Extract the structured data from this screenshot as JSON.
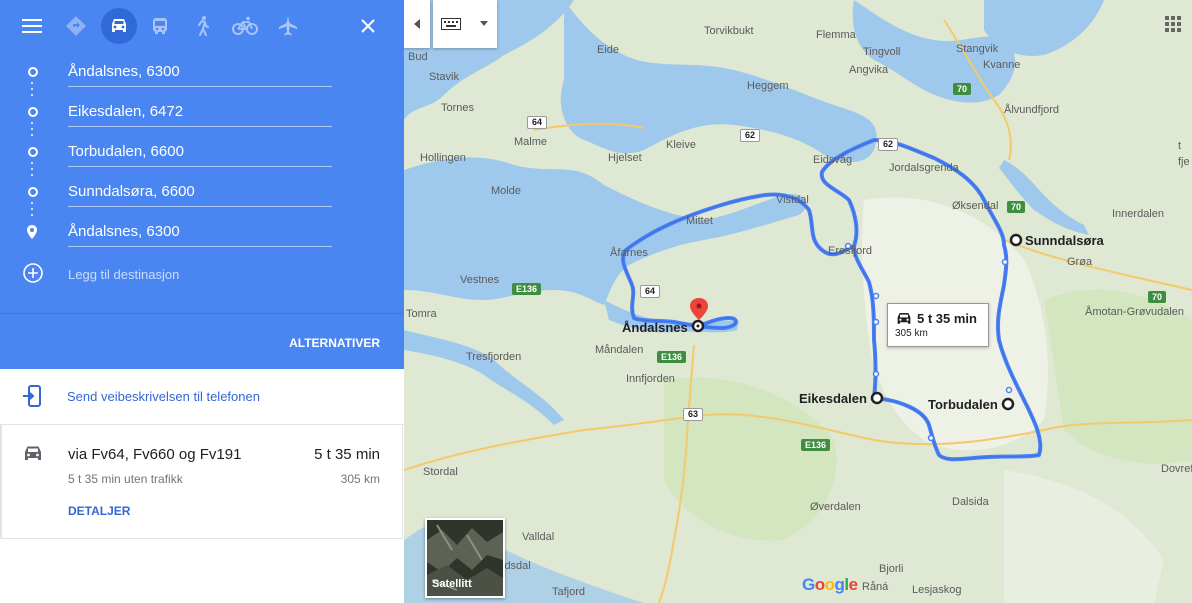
{
  "panel": {
    "modes": [
      {
        "name": "best",
        "icon": "directions-diamond-icon"
      },
      {
        "name": "car",
        "icon": "car-icon",
        "active": true
      },
      {
        "name": "transit",
        "icon": "bus-icon"
      },
      {
        "name": "walk",
        "icon": "walk-icon"
      },
      {
        "name": "bike",
        "icon": "bike-icon"
      },
      {
        "name": "flight",
        "icon": "airplane-icon"
      }
    ],
    "stops": [
      "Åndalsnes, 6300",
      "Eikesdalen, 6472",
      "Torbudalen, 6600",
      "Sunndalsøra, 6600",
      "Åndalsnes, 6300"
    ],
    "add_destination_placeholder": "Legg til destinasjon",
    "alternatives_label": "ALTERNATIVER",
    "send_to_phone_label": "Send veibeskrivelsen til telefonen",
    "route": {
      "via": "via Fv64, Fv660 og Fv191",
      "time": "5 t 35 min",
      "no_traffic": "5 t 35 min uten trafikk",
      "distance": "305 km",
      "details_label": "DETALJER"
    },
    "colors": {
      "header": "#4a86f2",
      "link": "#3367d6"
    }
  },
  "map": {
    "route_color": "#4a80f5",
    "info_box": {
      "time": "5 t 35 min",
      "distance": "305 km"
    },
    "satellite_label": "Satellitt",
    "logo": "Google",
    "places": {
      "bud": "Bud",
      "eide": "Eide",
      "torvikbukt": "Torvikbukt",
      "flemma": "Flemma",
      "tingvoll": "Tingvoll",
      "stangvik": "Stangvik",
      "kvanne": "Kvanne",
      "stavik": "Stavik",
      "angvika": "Angvika",
      "heggem": "Heggem",
      "alvundfjord": "Ålvundfjord",
      "tornes": "Tornes",
      "kleive": "Kleive",
      "malme": "Malme",
      "hollingen": "Hollingen",
      "hjelset": "Hjelset",
      "eidsvag": "Eidsvåg",
      "jordalsgrenda": "Jordalsgrenda",
      "molde": "Molde",
      "oksendal": "Øksendal",
      "innerdalen": "Innerdalen",
      "vistdal": "Vistdal",
      "mittet": "Mittet",
      "sunndalsora": "Sunndalsøra",
      "afarnes": "Åfarnes",
      "eresfjord": "Eresfjord",
      "groa": "Grøa",
      "vestnes": "Vestnes",
      "amotan": "Åmotan-Grøvudalen",
      "tomra": "Tomra",
      "andalsnes": "Åndalsnes",
      "tresfjorden": "Tresfjorden",
      "mandalen": "Måndalen",
      "innfjorden": "Innfjorden",
      "eikesdalen": "Eikesdalen",
      "torbudalen": "Torbudalen",
      "stordal": "Stordal",
      "dovrefjell": "Dovrefje",
      "overdalen": "Øverdalen",
      "dalsida": "Dalsida",
      "valldal": "Valldal",
      "eidsdal": "idsdal",
      "bjorli": "Bjorli",
      "rana": "Råná",
      "tafjord": "Tafjord",
      "lesjaskog": "Lesjaskog",
      "tfje": "t\nfje"
    },
    "roads": {
      "r64a": "64",
      "r62a": "62",
      "r62b": "62",
      "r70a": "70",
      "r70b": "70",
      "r70c": "70",
      "e136a": "E136",
      "r64b": "64",
      "e136b": "E136",
      "r63": "63",
      "e136c": "E136"
    }
  }
}
